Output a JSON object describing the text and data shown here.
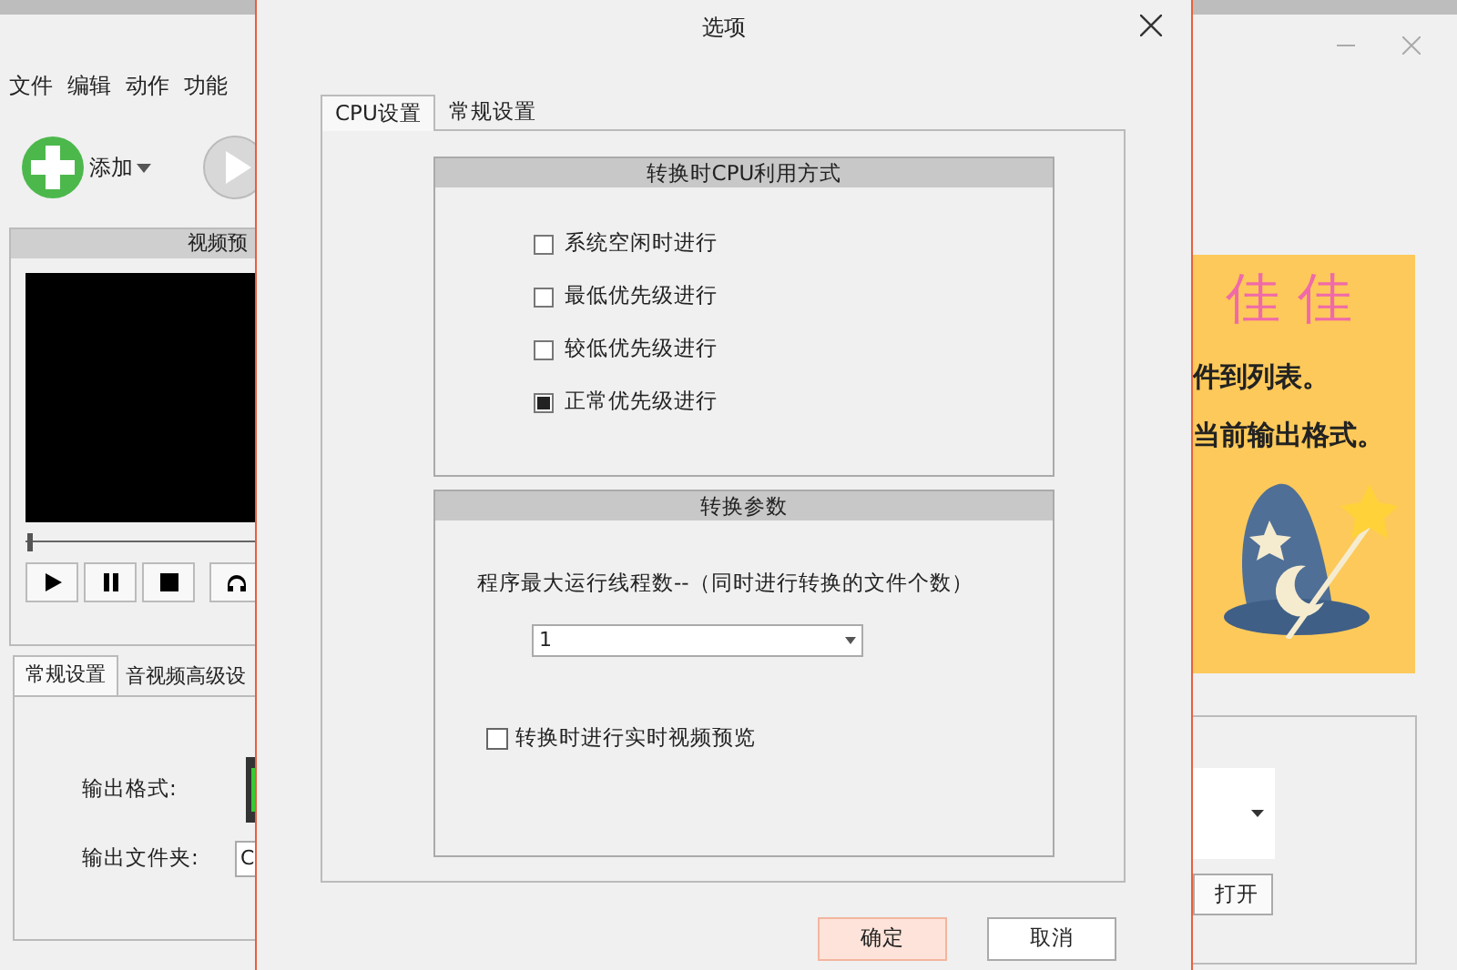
{
  "background_window": {
    "menu": [
      "文件",
      "编辑",
      "动作",
      "功能"
    ],
    "add_button": "添加",
    "preview": {
      "title": "视频预",
      "seek": {
        "level": 0
      }
    },
    "tabs": [
      {
        "label": "常规设置",
        "selected": true
      },
      {
        "label": "音视频高级设",
        "selected": false
      }
    ],
    "fields": [
      {
        "label": "输出格式:"
      },
      {
        "label": "输出文件夹:",
        "value": "C"
      }
    ],
    "banner": {
      "title": "佳 佳",
      "lines": [
        "件到列表。",
        "当前输出格式。"
      ]
    },
    "open_button": "打开"
  },
  "dialog": {
    "title": "选项",
    "tabs": [
      {
        "label": "CPU设置",
        "selected": true
      },
      {
        "label": "常规设置",
        "selected": false
      }
    ],
    "cpu_group": {
      "title": "转换时CPU利用方式",
      "options": [
        {
          "label": "系统空闲时进行",
          "selected": false
        },
        {
          "label": "最低优先级进行",
          "selected": false
        },
        {
          "label": "较低优先级进行",
          "selected": false
        },
        {
          "label": "正常优先级进行",
          "selected": true
        }
      ]
    },
    "params_group": {
      "title": "转换参数",
      "threads_label": "程序最大运行线程数--（同时进行转换的文件个数）",
      "threads_value": "1",
      "preview_option": {
        "label": "转换时进行实时视频预览",
        "checked": false
      }
    },
    "buttons": [
      {
        "label": "确定",
        "default": true
      },
      {
        "label": "取消",
        "default": false
      }
    ]
  }
}
